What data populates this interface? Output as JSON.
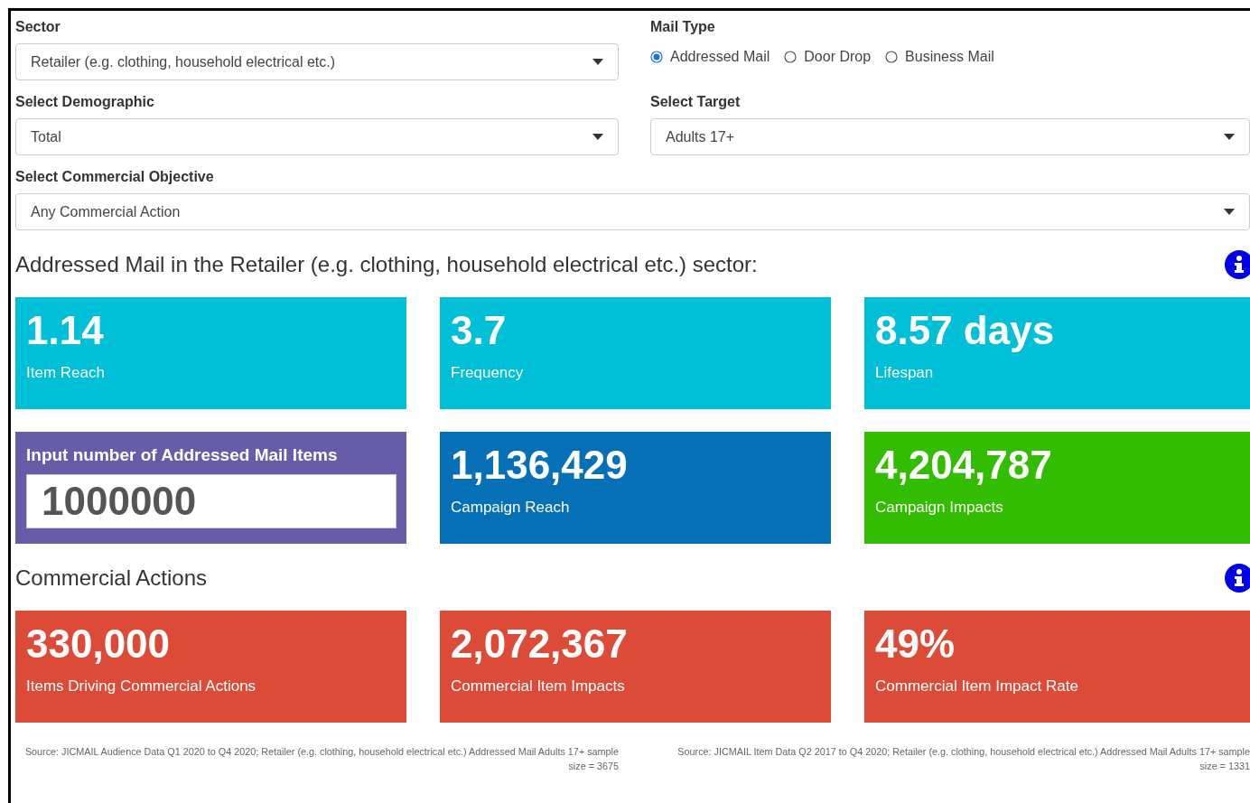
{
  "filters": {
    "sector": {
      "label": "Sector",
      "value": "Retailer (e.g. clothing, household electrical etc.)"
    },
    "mail_type": {
      "label": "Mail Type",
      "options": [
        {
          "label": "Addressed Mail",
          "selected": true
        },
        {
          "label": "Door Drop",
          "selected": false
        },
        {
          "label": "Business Mail",
          "selected": false
        }
      ]
    },
    "demographic": {
      "label": "Select Demographic",
      "value": "Total"
    },
    "target": {
      "label": "Select Target",
      "value": "Adults 17+"
    },
    "objective": {
      "label": "Select Commercial Objective",
      "value": "Any Commercial Action"
    }
  },
  "summary": {
    "heading": "Addressed Mail in the Retailer (e.g. clothing, household electrical etc.) sector:",
    "tiles": [
      {
        "kind": "stat",
        "value": "1.14",
        "label": "Item Reach",
        "color": "#00bfd6"
      },
      {
        "kind": "stat",
        "value": "3.7",
        "label": "Frequency",
        "color": "#00bfd6"
      },
      {
        "kind": "stat",
        "value": "8.57 days",
        "label": "Lifespan",
        "color": "#00bfd6"
      },
      {
        "kind": "input",
        "label": "Input number of Addressed Mail Items",
        "value": "1000000",
        "color": "#665ca8"
      },
      {
        "kind": "stat",
        "value": "1,136,429",
        "label": "Campaign Reach",
        "color": "#0570b5"
      },
      {
        "kind": "stat",
        "value": "4,204,787",
        "label": "Campaign Impacts",
        "color": "#33bd00"
      }
    ]
  },
  "commercial": {
    "heading": "Commercial Actions",
    "tiles": [
      {
        "kind": "stat",
        "value": "330,000",
        "label": "Items Driving Commercial Actions",
        "color": "#dc4b38"
      },
      {
        "kind": "stat",
        "value": "2,072,367",
        "label": "Commercial Item Impacts",
        "color": "#dc4b38"
      },
      {
        "kind": "stat",
        "value": "49%",
        "label": "Commercial Item Impact Rate",
        "color": "#dc4b38"
      }
    ]
  },
  "sources": [
    "Source: JICMAIL Audience Data Q1 2020 to Q4 2020; Retailer (e.g. clothing, household electrical etc.) Addressed Mail Adults 17+ sample size = 3675",
    "Source: JICMAIL Item Data Q2 2017 to Q4 2020; Retailer (e.g. clothing, household electrical etc.) Addressed Mail Adults 17+ sample size = 1331"
  ]
}
